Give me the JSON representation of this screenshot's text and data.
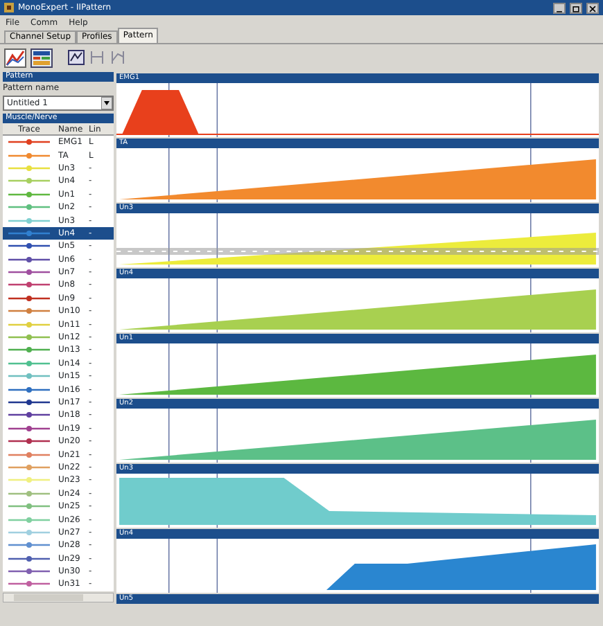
{
  "window": {
    "title": "MonoExpert - IIPattern"
  },
  "menu": [
    "File",
    "Comm",
    "Help"
  ],
  "tabs": [
    {
      "label": "Channel Setup",
      "selected": false
    },
    {
      "label": "Profiles",
      "selected": false
    },
    {
      "label": "Pattern",
      "selected": true
    }
  ],
  "pattern_panel": {
    "title": "Pattern",
    "field_label": "Pattern name",
    "value": "Untitled 1"
  },
  "muscle_panel": {
    "title": "Muscle/Nerve",
    "columns": [
      "Trace",
      "Name",
      "Lin"
    ],
    "rows": [
      {
        "name": "EMG1",
        "lin": "L",
        "color": "#e04020",
        "selected": false
      },
      {
        "name": "TA",
        "lin": "L",
        "color": "#f08a30",
        "selected": false
      },
      {
        "name": "Un3",
        "lin": "-",
        "color": "#e8e040",
        "selected": false
      },
      {
        "name": "Un4",
        "lin": "-",
        "color": "#a8d060",
        "selected": false
      },
      {
        "name": "Un1",
        "lin": "-",
        "color": "#60b840",
        "selected": false
      },
      {
        "name": "Un2",
        "lin": "-",
        "color": "#60c080",
        "selected": false
      },
      {
        "name": "Un3",
        "lin": "-",
        "color": "#80d0d0",
        "selected": false
      },
      {
        "name": "Un4",
        "lin": "-",
        "color": "#3080d0",
        "selected": true
      },
      {
        "name": "Un5",
        "lin": "-",
        "color": "#3050b0",
        "selected": false
      },
      {
        "name": "Un6",
        "lin": "-",
        "color": "#6050a8",
        "selected": false
      },
      {
        "name": "Un7",
        "lin": "-",
        "color": "#a050a0",
        "selected": false
      },
      {
        "name": "Un8",
        "lin": "-",
        "color": "#c04070",
        "selected": false
      },
      {
        "name": "Un9",
        "lin": "-",
        "color": "#c03020",
        "selected": false
      },
      {
        "name": "Un10",
        "lin": "-",
        "color": "#d08040",
        "selected": false
      },
      {
        "name": "Un11",
        "lin": "-",
        "color": "#e0d040",
        "selected": false
      },
      {
        "name": "Un12",
        "lin": "-",
        "color": "#90c050",
        "selected": false
      },
      {
        "name": "Un13",
        "lin": "-",
        "color": "#50b050",
        "selected": false
      },
      {
        "name": "Un14",
        "lin": "-",
        "color": "#50c090",
        "selected": false
      },
      {
        "name": "Un15",
        "lin": "-",
        "color": "#70c0c0",
        "selected": false
      },
      {
        "name": "Un16",
        "lin": "-",
        "color": "#3070c0",
        "selected": false
      },
      {
        "name": "Un17",
        "lin": "-",
        "color": "#203890",
        "selected": false
      },
      {
        "name": "Un18",
        "lin": "-",
        "color": "#6040a0",
        "selected": false
      },
      {
        "name": "Un19",
        "lin": "-",
        "color": "#a04090",
        "selected": false
      },
      {
        "name": "Un20",
        "lin": "-",
        "color": "#b03050",
        "selected": false
      },
      {
        "name": "Un21",
        "lin": "-",
        "color": "#e08060",
        "selected": false
      },
      {
        "name": "Un22",
        "lin": "-",
        "color": "#e0a060",
        "selected": false
      },
      {
        "name": "Un23",
        "lin": "-",
        "color": "#f0f080",
        "selected": false
      },
      {
        "name": "Un24",
        "lin": "-",
        "color": "#a0c080",
        "selected": false
      },
      {
        "name": "Un25",
        "lin": "-",
        "color": "#80c080",
        "selected": false
      },
      {
        "name": "Un26",
        "lin": "-",
        "color": "#80d0a0",
        "selected": false
      },
      {
        "name": "Un27",
        "lin": "-",
        "color": "#a0d0e0",
        "selected": false
      },
      {
        "name": "Un28",
        "lin": "-",
        "color": "#6090d0",
        "selected": false
      },
      {
        "name": "Un29",
        "lin": "-",
        "color": "#5060b0",
        "selected": false
      },
      {
        "name": "Un30",
        "lin": "-",
        "color": "#8060b0",
        "selected": false
      },
      {
        "name": "Un31",
        "lin": "-",
        "color": "#c060a0",
        "selected": false
      }
    ]
  },
  "profiles": [
    {
      "label": "EMG1",
      "kind": "pulse",
      "color": "#e8401c"
    },
    {
      "label": "TA",
      "kind": "ramp",
      "color": "#f28a2e"
    },
    {
      "label": "Un3",
      "kind": "dashed-ramp",
      "color": "#ecec3c"
    },
    {
      "label": "Un4",
      "kind": "ramp",
      "color": "#a8d050"
    },
    {
      "label": "Un1",
      "kind": "ramp",
      "color": "#5cb840"
    },
    {
      "label": "Un2",
      "kind": "ramp",
      "color": "#5cc088"
    },
    {
      "label": "Un3",
      "kind": "step-down",
      "color": "#70cccc"
    },
    {
      "label": "Un4",
      "kind": "step-up",
      "color": "#2a86d0"
    },
    {
      "label": "Un5",
      "kind": "none"
    }
  ]
}
